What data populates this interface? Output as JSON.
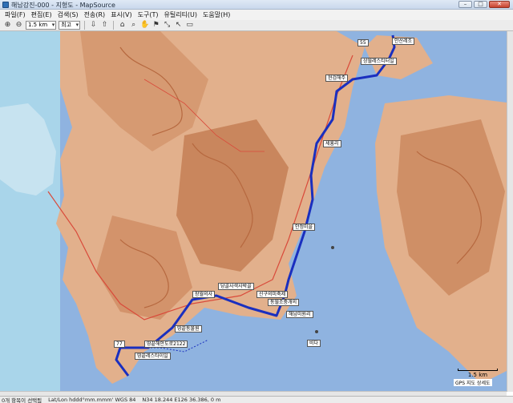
{
  "window": {
    "title": "해남강진-000 - 지형도 - MapSource"
  },
  "menu": [
    "파일(F)",
    "편집(E)",
    "검색(S)",
    "전송(R)",
    "표시(V)",
    "도구(T)",
    "유틸리티(U)",
    "도움말(H)"
  ],
  "toolbar": {
    "zoom_value": "1.5 km",
    "detail_value": "최고"
  },
  "map": {
    "labels": [
      "55",
      "안산레조",
      "상월레스티터일",
      "현검해주",
      "세흥리",
      "안정미을",
      "신구의미축제",
      "동월조중개의",
      "해남미원리",
      "당골사색사박골",
      "장월의사",
      "땅끝동물원",
      "땅끝해안도로2122",
      "땅끝레스타이일",
      "77",
      "비다",
      "GPS 지도 상세도"
    ],
    "scale_text": "1.5 km",
    "route_color": "#1a2fbf",
    "sea_color": "#8fb3e0",
    "land_color": "#e2b08c",
    "relief_color": "#b6683f"
  },
  "status": {
    "selection": "0개 항목이 선택됨",
    "format": "Lat/Lon hddd°mm.mmm' WGS 84",
    "coords": "N34 18.244 E126 36.386, 0 m"
  }
}
